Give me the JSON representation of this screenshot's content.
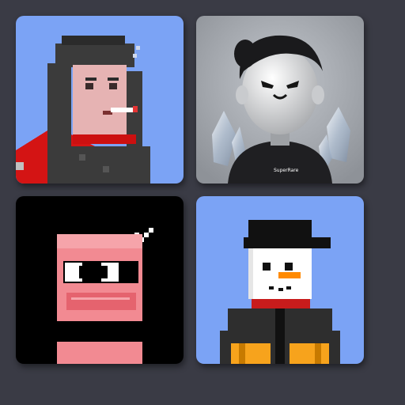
{
  "gallery": {
    "items": [
      {
        "id": "avatar-1",
        "icon": "pixel-punk-cigarette",
        "bg": "#7ba3f5"
      },
      {
        "id": "avatar-2",
        "icon": "3d-character-crystals",
        "bg": "#a9adb4",
        "hoodie_text": "SuperRare"
      },
      {
        "id": "avatar-3",
        "icon": "pixel-pink-ninja",
        "bg": "#000000"
      },
      {
        "id": "avatar-4",
        "icon": "pixel-snowman-beanie",
        "bg": "#7ba3f5"
      }
    ]
  }
}
